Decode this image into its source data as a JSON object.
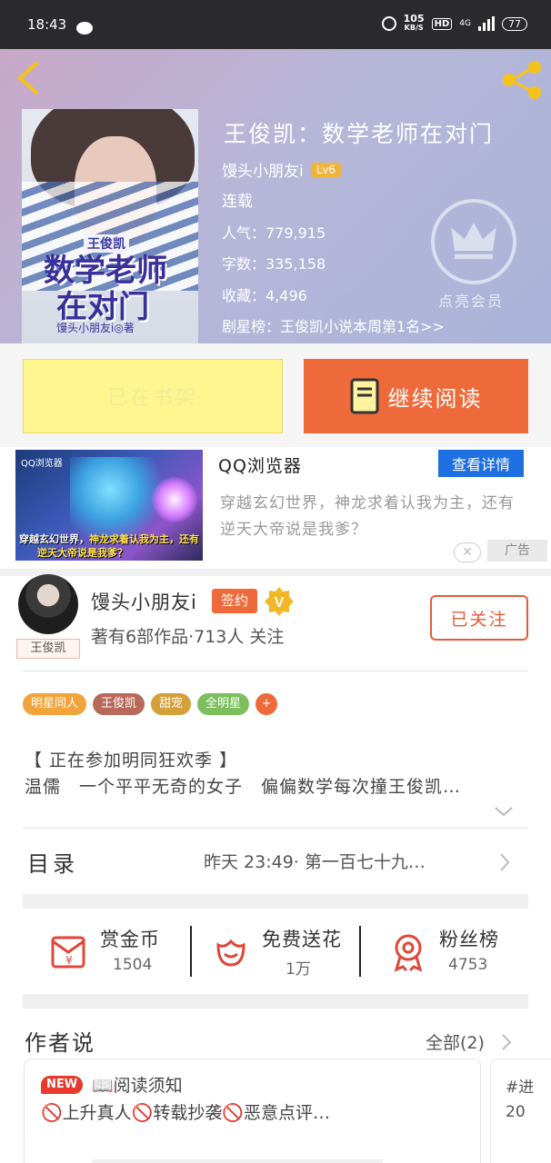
{
  "statusbar": {
    "time": "18:43",
    "net_speed": "105",
    "net_unit": "KB/S",
    "hd": "HD",
    "network": "4G",
    "battery": "77"
  },
  "book": {
    "title": "王俊凯：数学老师在对门",
    "author": "馒头小朋友i",
    "level": "Lv6",
    "status": "连载",
    "popularity": "人气：779,915",
    "words": "字数：335,158",
    "favorites": "收藏：4,496",
    "rank": "剧星榜：王俊凯小说本周第1名>>",
    "vip_label": "点亮会员",
    "cover": {
      "subtitle": "王俊凯",
      "title_line1": "数学老师",
      "title_line2": "在对门",
      "author": "馒头小朋友i◎著"
    }
  },
  "actions": {
    "shelf_label": "已在书架",
    "read_label": "继续阅读"
  },
  "ad": {
    "title": "QQ浏览器",
    "button": "查看详情",
    "desc": "穿越玄幻世界，神龙求着认我为主，还有逆天大帝说是我爹？",
    "close": "✕",
    "tag": "广告",
    "img_logo": "QQ浏览器",
    "img_caption1_a": "穿越玄幻世界，",
    "img_caption1_b": "神龙求着认我为主，还有",
    "img_caption2": "逆天大帝说是我爹？"
  },
  "author_info": {
    "name": "馒头小朋友i",
    "sign_badge": "签约",
    "avatar_tag": "王俊凯",
    "works": "著有6部作品·713人 关注",
    "follow_label": "已关注"
  },
  "tags": [
    {
      "label": "明星同人",
      "color": "#f0a43a"
    },
    {
      "label": "王俊凯",
      "color": "#b8695a"
    },
    {
      "label": "甜宠",
      "color": "#d3a03a"
    },
    {
      "label": "全明星",
      "color": "#7cbf5c"
    },
    {
      "label": "+",
      "color": "#ef6a3a"
    }
  ],
  "intro": {
    "line1": "【 正在参加明同狂欢季 】",
    "line2": "温儒　一个平平无奇的女子　偏偏数学每次撞王俊凯…"
  },
  "catalog": {
    "label": "目录",
    "latest": "昨天 23:49· 第一百七十九…"
  },
  "rewards": [
    {
      "label": "赏金币",
      "value": "1504",
      "icon": "red-envelope-icon"
    },
    {
      "label": "免费送花",
      "value": "1万",
      "icon": "flower-icon"
    },
    {
      "label": "粉丝榜",
      "value": "4753",
      "icon": "medal-icon"
    }
  ],
  "author_says": {
    "title": "作者说",
    "all_label": "全部(2)",
    "card": {
      "new_badge": "NEW",
      "title": "📖阅读须知",
      "text": "🚫上升真人🚫转载抄袭🚫恶意点评…"
    },
    "card2_line1": "#进",
    "card2_line2": "20"
  },
  "colors": {
    "accent": "#ef6a3a",
    "shelf": "#fff58f",
    "ad_button": "#1e6fe0"
  }
}
